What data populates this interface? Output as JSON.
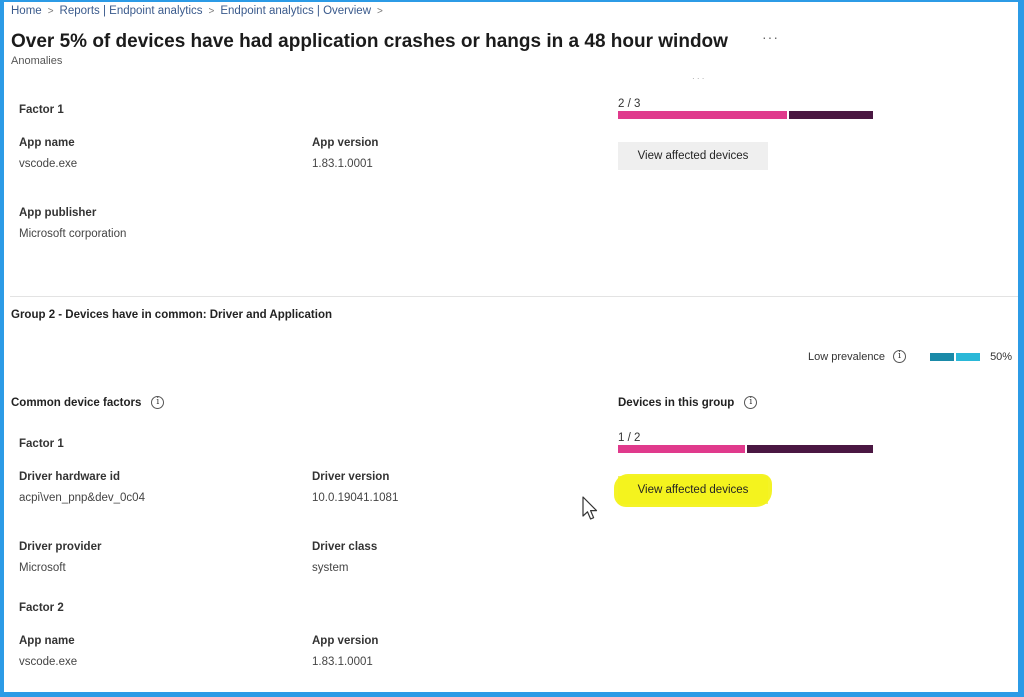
{
  "breadcrumb": [
    "Home",
    "Reports | Endpoint analytics",
    "Endpoint analytics | Overview"
  ],
  "page": {
    "title": "Over 5% of devices have had application crashes or hangs in a 48 hour window",
    "more": "···",
    "subtitle": "Anomalies"
  },
  "group1": {
    "factor1": {
      "label": "Factor 1",
      "app_name_label": "App name",
      "app_name_value": "vscode.exe",
      "app_version_label": "App version",
      "app_version_value": "1.83.1.0001",
      "app_publisher_label": "App publisher",
      "app_publisher_value": "Microsoft corporation"
    },
    "devices": {
      "fraction": "2 / 3",
      "affected": 2,
      "total": 3,
      "button": "View affected devices"
    }
  },
  "group2": {
    "title": "Group 2 - Devices have in common: Driver and Application",
    "prevalence_label": "Low prevalence",
    "prevalence_percent": "50%",
    "prevalence_value": 0.5,
    "common_factors_header": "Common device factors",
    "devices_header": "Devices in this group",
    "factor1": {
      "label": "Factor 1",
      "driver_hw_label": "Driver hardware id",
      "driver_hw_value": "acpi\\ven_pnp&dev_0c04",
      "driver_version_label": "Driver version",
      "driver_version_value": "10.0.19041.1081",
      "driver_provider_label": "Driver provider",
      "driver_provider_value": "Microsoft",
      "driver_class_label": "Driver class",
      "driver_class_value": "system"
    },
    "factor2": {
      "label": "Factor 2",
      "app_name_label": "App name",
      "app_name_value": "vscode.exe",
      "app_version_label": "App version",
      "app_version_value": "1.83.1.0001"
    },
    "devices": {
      "fraction": "1 / 2",
      "affected": 1,
      "total": 2,
      "button": "View affected devices"
    }
  },
  "colors": {
    "affected": "#e03a8c",
    "unaffected": "#4a1742",
    "prevalence_dark": "#1a8aa8",
    "prevalence_light": "#2ab8d8",
    "highlight": "#f3f21a",
    "frame": "#2c9be6"
  },
  "icons": {
    "info": "info-icon",
    "cursor": "mouse-pointer-icon",
    "breadcrumb_sep": "chevron-right-icon"
  }
}
